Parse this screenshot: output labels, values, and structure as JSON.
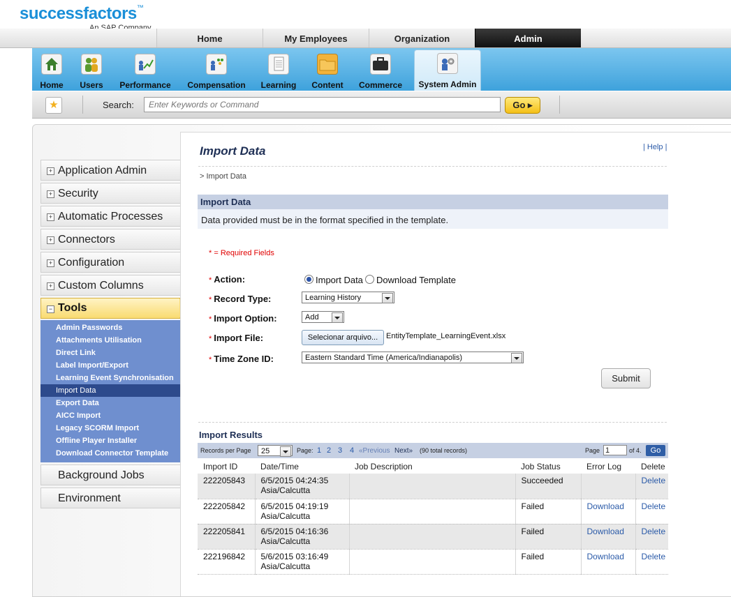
{
  "logo": {
    "brand": "successfactors",
    "tm": "™",
    "subtitle": "An SAP Company"
  },
  "topnav": {
    "tabs": [
      "Home",
      "My Employees",
      "Organization",
      "Admin"
    ],
    "active": "Admin"
  },
  "iconbar": {
    "items": [
      "Home",
      "Users",
      "Performance",
      "Compensation",
      "Learning",
      "Content",
      "Commerce",
      "System Admin"
    ],
    "active": "System Admin"
  },
  "search": {
    "label": "Search:",
    "placeholder": "Enter Keywords or Command",
    "go": "Go ▸"
  },
  "sidebar": {
    "items": [
      "Application Admin",
      "Security",
      "Automatic Processes",
      "Connectors",
      "Configuration",
      "Custom Columns"
    ],
    "tools": {
      "label": "Tools",
      "submenu": [
        "Admin Passwords",
        "Attachments Utilisation",
        "Direct Link",
        "Label Import/Export",
        "Learning Event Synchronisation",
        "Import Data",
        "Export Data",
        "AICC Import",
        "Legacy SCORM Import",
        "Offline Player Installer",
        "Download Connector Template"
      ],
      "selected": "Import Data"
    },
    "bottom": [
      "Background Jobs",
      "Environment"
    ],
    "expand_glyph": "+",
    "collapse_glyph": "−"
  },
  "page": {
    "title": "Import Data",
    "help": "| Help |",
    "breadcrumb": "> Import Data",
    "section_title": "Import Data",
    "section_desc": "Data provided must be in the format specified in the template."
  },
  "form": {
    "required_note": "* = Required Fields",
    "asterisk": "*",
    "action_label": "Action:",
    "action_options": [
      "Import Data",
      "Download Template"
    ],
    "action_selected": "Import Data",
    "record_type_label": "Record Type:",
    "record_type_value": "Learning History",
    "import_option_label": "Import Option:",
    "import_option_value": "Add",
    "import_file_label": "Import File:",
    "file_button": "Selecionar arquivo...",
    "file_name": "EntityTemplate_LearningEvent.xlsx",
    "timezone_label": "Time Zone ID:",
    "timezone_value": "Eastern Standard Time (America/Indianapolis)",
    "submit": "Submit"
  },
  "results": {
    "title": "Import Results",
    "records_per_page_label": "Records per Page",
    "records_per_page": "25",
    "page_label": "Page:",
    "pages": [
      "1",
      "2",
      "3",
      "4"
    ],
    "previous": "«Previous",
    "next": "Next»",
    "total": "(90 total records)",
    "page_input_label": "Page",
    "page_input": "1",
    "of_pages": "of 4.",
    "go": "Go",
    "columns": [
      "Import ID",
      "Date/Time",
      "Job Description",
      "Job Status",
      "Error Log",
      "Delete"
    ],
    "rows": [
      {
        "id": "222205843",
        "date": "6/5/2015 04:24:35",
        "tz": "Asia/Calcutta",
        "desc": "",
        "status": "Succeeded",
        "log": "",
        "del": "Delete"
      },
      {
        "id": "222205842",
        "date": "6/5/2015 04:19:19",
        "tz": "Asia/Calcutta",
        "desc": "",
        "status": "Failed",
        "log": "Download",
        "del": "Delete"
      },
      {
        "id": "222205841",
        "date": "6/5/2015 04:16:36",
        "tz": "Asia/Calcutta",
        "desc": "",
        "status": "Failed",
        "log": "Download",
        "del": "Delete"
      },
      {
        "id": "222196842",
        "date": "5/6/2015 03:16:49",
        "tz": "Asia/Calcutta",
        "desc": "",
        "status": "Failed",
        "log": "Download",
        "del": "Delete"
      }
    ]
  },
  "colors": {
    "accent": "#1a8fd8",
    "iconbar": "#3ea2dc",
    "tools_highlight": "#f9db71",
    "submenu": "#6f8fcf",
    "link": "#2a5aa8"
  }
}
